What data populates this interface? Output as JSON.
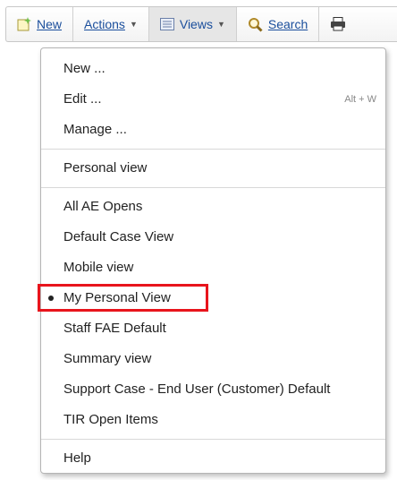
{
  "toolbar": {
    "new_label": "New",
    "actions_label": "Actions",
    "views_label": "Views",
    "search_label": "Search"
  },
  "menu": {
    "group1": [
      {
        "label": "New ...",
        "shortcut": ""
      },
      {
        "label": "Edit ...",
        "shortcut": "Alt + W"
      },
      {
        "label": "Manage ...",
        "shortcut": ""
      }
    ],
    "group2": [
      {
        "label": "Personal view"
      }
    ],
    "views": [
      {
        "label": "All AE Opens"
      },
      {
        "label": "Default Case View"
      },
      {
        "label": "Mobile view"
      },
      {
        "label": "My Personal View",
        "selected": true
      },
      {
        "label": "Staff FAE Default"
      },
      {
        "label": "Summary view"
      },
      {
        "label": "Support Case - End User (Customer) Default"
      },
      {
        "label": "TIR Open Items"
      }
    ],
    "group4": [
      {
        "label": "Help"
      }
    ]
  },
  "colors": {
    "link": "#1a4e9c",
    "highlight_box": "#e8141c"
  }
}
